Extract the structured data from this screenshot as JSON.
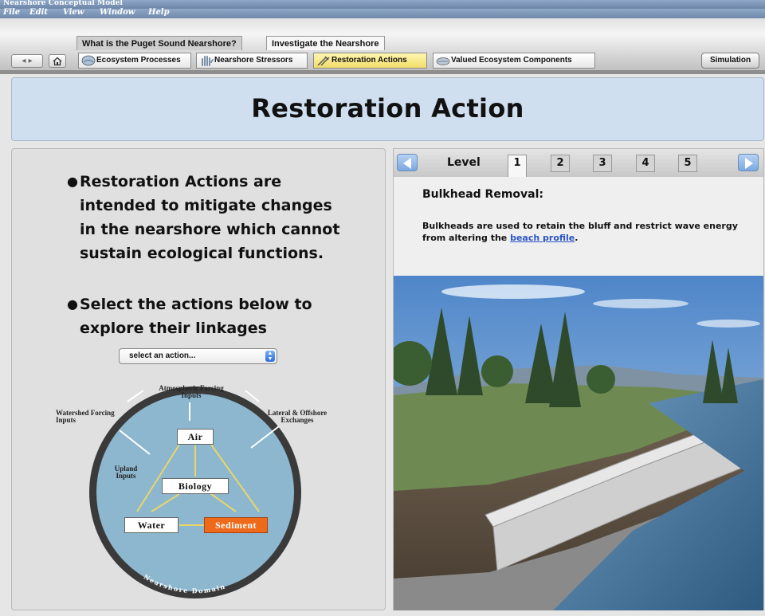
{
  "window": {
    "title": "Nearshore Conceptual Model"
  },
  "menu": [
    "File",
    "Edit",
    "View",
    "Window",
    "Help"
  ],
  "tabs": [
    {
      "label": "What is the Puget Sound Nearshore?",
      "active": false
    },
    {
      "label": "Investigate the Nearshore",
      "active": true
    }
  ],
  "nav": {
    "back_forward": "◂ ▸",
    "home_icon": "house-icon"
  },
  "subtabs": [
    {
      "label": "Ecosystem Processes",
      "icon": "ecosystem-icon",
      "active": false
    },
    {
      "label": "Nearshore Stressors",
      "icon": "hand-icon",
      "active": false
    },
    {
      "label": "Restoration Actions",
      "icon": "tools-icon",
      "active": true
    },
    {
      "label": "Valued Ecosystem Components",
      "icon": "shell-icon",
      "active": false
    }
  ],
  "simulation_label": "Simulation",
  "header": {
    "title": "Restoration Action"
  },
  "left": {
    "bullets": [
      [
        "Restoration Actions are",
        "intended to mitigate changes",
        "in the nearshore which cannot",
        "sustain ecological functions."
      ],
      [
        "Select the actions below to",
        "explore their linkages"
      ]
    ],
    "select": {
      "value": "select an action..."
    },
    "diagram": {
      "labels": {
        "atmospheric": [
          "Atmospheric Forcing",
          "Inputs"
        ],
        "watershed": [
          "Watershed Forcing",
          "Inputs"
        ],
        "lateral": [
          "Lateral & Offshore",
          "Exchanges"
        ],
        "upland": [
          "Upland",
          "Inputs"
        ],
        "domain": "Nearshore Domain"
      },
      "boxes": {
        "air": "Air",
        "biology": "Biology",
        "water": "Water",
        "sediment": "Sediment"
      }
    }
  },
  "right": {
    "level_label": "Level",
    "levels": [
      "1",
      "2",
      "3",
      "4",
      "5"
    ],
    "active_level": "1",
    "title": "Bulkhead Removal:",
    "desc_before": "Bulkheads are used to retain the bluff and restrict wave energy from altering the ",
    "desc_link": "beach profile",
    "desc_after": "."
  },
  "colors": {
    "banner": "#cfdff0",
    "active_subtab": "#f2de6a",
    "sediment": "#ee6a1a",
    "domain_circle": "#8db7cf",
    "link": "#2a55c8"
  }
}
